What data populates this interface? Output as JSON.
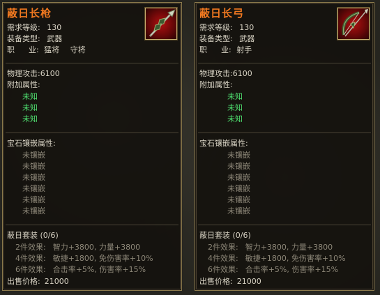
{
  "tooltips": [
    {
      "name": "蔽日长枪",
      "icon": "spear-icon",
      "level_label": "需求等级:",
      "level_value": "130",
      "type_label": "装备类型:",
      "type_value": "武器",
      "job_label_a": "职",
      "job_label_b": "业:",
      "job_value_1": "猛将",
      "job_value_2": "守将",
      "attack": "物理攻击:6100",
      "extra_label": "附加属性:",
      "extra_items": [
        "未知",
        "未知",
        "未知"
      ],
      "gem_label": "宝石镶嵌属性:",
      "gem_items": [
        "未镶嵌",
        "未镶嵌",
        "未镶嵌",
        "未镶嵌",
        "未镶嵌",
        "未镶嵌"
      ],
      "set_name": "蔽日套装 (0/6)",
      "set_effects": [
        {
          "label": "2件效果:",
          "value": "智力+3800, 力量+3800"
        },
        {
          "label": "4件效果:",
          "value": "敏捷+1800, 免伤害率+10%"
        },
        {
          "label": "6件效果:",
          "value": "合击率+5%, 伤害率+15%"
        }
      ],
      "price_label": "出售价格:",
      "price_value": "21000"
    },
    {
      "name": "蔽日长弓",
      "icon": "bow-icon",
      "level_label": "需求等级:",
      "level_value": "130",
      "type_label": "装备类型:",
      "type_value": "武器",
      "job_label_a": "职",
      "job_label_b": "业:",
      "job_value_1": "射手",
      "job_value_2": "",
      "attack": "物理攻击:6100",
      "extra_label": "附加属性:",
      "extra_items": [
        "未知",
        "未知",
        "未知"
      ],
      "gem_label": "宝石镶嵌属性:",
      "gem_items": [
        "未镶嵌",
        "未镶嵌",
        "未镶嵌",
        "未镶嵌",
        "未镶嵌",
        "未镶嵌"
      ],
      "set_name": "蔽日套装 (0/6)",
      "set_effects": [
        {
          "label": "2件效果:",
          "value": "智力+3800, 力量+3800"
        },
        {
          "label": "4件效果:",
          "value": "敏捷+1800, 免伤害率+10%"
        },
        {
          "label": "6件效果:",
          "value": "合击率+5%, 伤害率+15%"
        }
      ],
      "price_label": "出售价格:",
      "price_value": "21000"
    }
  ],
  "colors": {
    "title": "#f07820",
    "unknown_attr": "#4fe070",
    "inactive": "#8d8778",
    "border": "#8c7a4c"
  }
}
